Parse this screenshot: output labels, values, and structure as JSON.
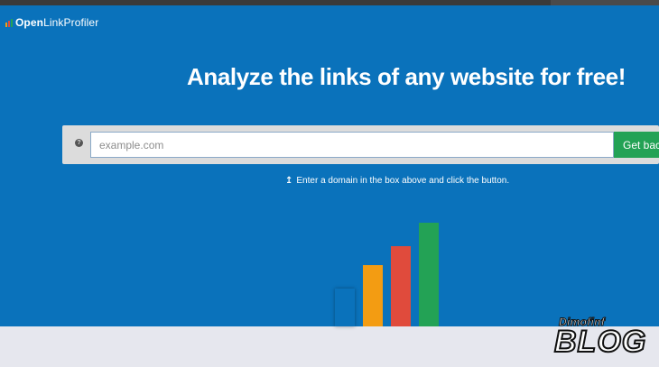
{
  "logo": {
    "brand_open": "Open",
    "brand_rest": "LinkProfiler",
    "bar_colors": [
      "#f39c12",
      "#e04b3c",
      "#23a255"
    ]
  },
  "hero": {
    "headline": "Analyze the links of any website for free!",
    "background": "#0a72bb"
  },
  "search": {
    "placeholder": "example.com",
    "value": "",
    "help_icon": "question-circle-icon",
    "button_label": "Get back"
  },
  "hint": {
    "icon": "arrow-up-icon",
    "text": "Enter a domain in the box above and click the button."
  },
  "illustration": {
    "bar_colors": [
      "#0a72bb",
      "#f39c12",
      "#e04b3c",
      "#23a255"
    ]
  },
  "watermark": {
    "small_text": "Dimofinf",
    "big_text": "BLOG"
  }
}
